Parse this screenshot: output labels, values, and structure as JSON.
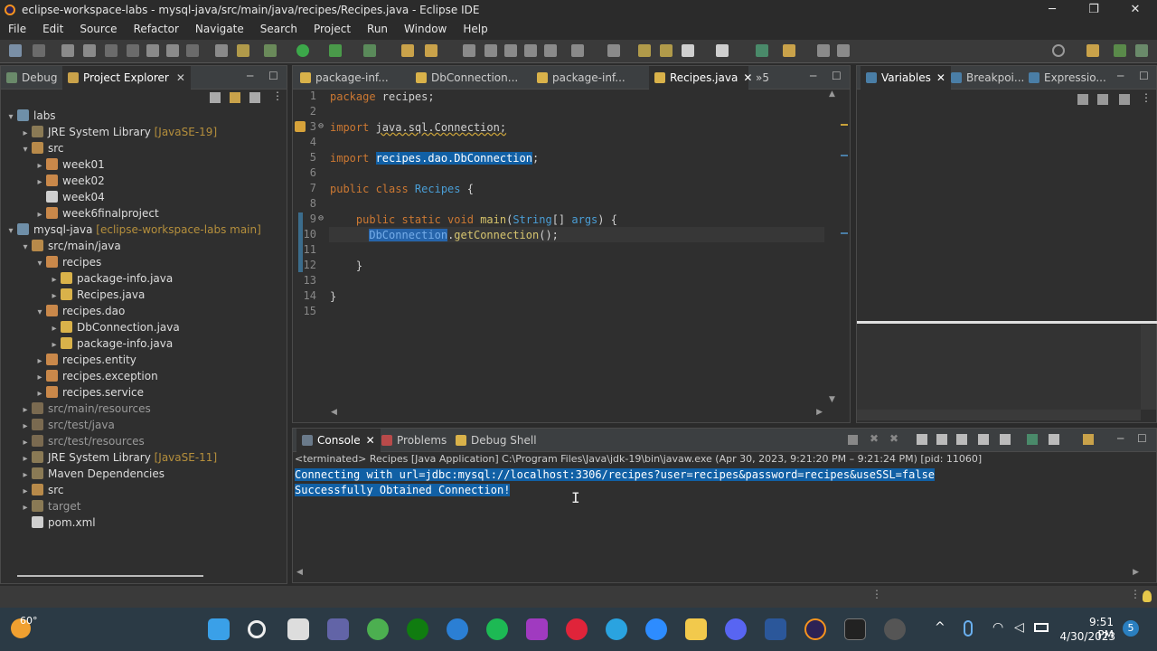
{
  "window": {
    "title": "eclipse-workspace-labs - mysql-java/src/main/java/recipes/Recipes.java - Eclipse IDE",
    "minimize": "─",
    "maximize": "❐",
    "close": "✕"
  },
  "menu": [
    "File",
    "Edit",
    "Source",
    "Refactor",
    "Navigate",
    "Search",
    "Project",
    "Run",
    "Window",
    "Help"
  ],
  "left_tabs": {
    "debug": "Debug",
    "project_explorer": "Project Explorer"
  },
  "tree": [
    {
      "label": "labs",
      "deco": "",
      "depth": 0,
      "arrow": "▾",
      "icon": "#6f8fa8"
    },
    {
      "label": "JRE System Library ",
      "deco": "[JavaSE-19]",
      "depth": 1,
      "arrow": "▸",
      "icon": "#8a7a55"
    },
    {
      "label": "src",
      "deco": "",
      "depth": 1,
      "arrow": "▾",
      "icon": "#b88a4a"
    },
    {
      "label": "week01",
      "deco": "",
      "depth": 2,
      "arrow": "▸",
      "icon": "#c9884a"
    },
    {
      "label": "week02",
      "deco": "",
      "depth": 2,
      "arrow": "▸",
      "icon": "#c9884a"
    },
    {
      "label": "week04",
      "deco": "",
      "depth": 2,
      "arrow": "",
      "icon": "#cfcfcf"
    },
    {
      "label": "week6finalproject",
      "deco": "",
      "depth": 2,
      "arrow": "▸",
      "icon": "#c9884a"
    },
    {
      "label": "mysql-java ",
      "deco": "[eclipse-workspace-labs main]",
      "depth": 0,
      "arrow": "▾",
      "icon": "#6f8fa8"
    },
    {
      "label": "src/main/java",
      "deco": "",
      "depth": 1,
      "arrow": "▾",
      "icon": "#b88a4a"
    },
    {
      "label": "recipes",
      "deco": "",
      "depth": 2,
      "arrow": "▾",
      "icon": "#c9884a"
    },
    {
      "label": "package-info.java",
      "deco": "",
      "depth": 3,
      "arrow": "▸",
      "icon": "#d9b24a"
    },
    {
      "label": "Recipes.java",
      "deco": "",
      "depth": 3,
      "arrow": "▸",
      "icon": "#d9b24a"
    },
    {
      "label": "recipes.dao",
      "deco": "",
      "depth": 2,
      "arrow": "▾",
      "icon": "#c9884a"
    },
    {
      "label": "DbConnection.java",
      "deco": "",
      "depth": 3,
      "arrow": "▸",
      "icon": "#d9b24a"
    },
    {
      "label": "package-info.java",
      "deco": "",
      "depth": 3,
      "arrow": "▸",
      "icon": "#d9b24a"
    },
    {
      "label": "recipes.entity",
      "deco": "",
      "depth": 2,
      "arrow": "▸",
      "icon": "#c9884a"
    },
    {
      "label": "recipes.exception",
      "deco": "",
      "depth": 2,
      "arrow": "▸",
      "icon": "#c9884a"
    },
    {
      "label": "recipes.service",
      "deco": "",
      "depth": 2,
      "arrow": "▸",
      "icon": "#c9884a"
    },
    {
      "label": "src/main/resources",
      "deco": "",
      "depth": 1,
      "arrow": "▸",
      "icon": "#7a6a50",
      "dim": true
    },
    {
      "label": "src/test/java",
      "deco": "",
      "depth": 1,
      "arrow": "▸",
      "icon": "#7a6a50",
      "dim": true
    },
    {
      "label": "src/test/resources",
      "deco": "",
      "depth": 1,
      "arrow": "▸",
      "icon": "#7a6a50",
      "dim": true
    },
    {
      "label": "JRE System Library ",
      "deco": "[JavaSE-11]",
      "depth": 1,
      "arrow": "▸",
      "icon": "#8a7a55"
    },
    {
      "label": "Maven Dependencies",
      "deco": "",
      "depth": 1,
      "arrow": "▸",
      "icon": "#8a7a55"
    },
    {
      "label": "src",
      "deco": "",
      "depth": 1,
      "arrow": "▸",
      "icon": "#b88a4a"
    },
    {
      "label": "target",
      "deco": "",
      "depth": 1,
      "arrow": "▸",
      "icon": "#8a7a55",
      "dim": true
    },
    {
      "label": "pom.xml",
      "deco": "",
      "depth": 1,
      "arrow": "",
      "icon": "#cfcfcf"
    }
  ],
  "editor_tabs": [
    {
      "label": "package-inf..."
    },
    {
      "label": "DbConnection..."
    },
    {
      "label": "package-inf..."
    },
    {
      "label": "Recipes.java",
      "active": true
    },
    {
      "label": "»5"
    }
  ],
  "code_lines": [
    {
      "n": "1",
      "parts": [
        [
          "kw",
          "package "
        ],
        [
          "pl",
          "recipes;"
        ]
      ]
    },
    {
      "n": "2",
      "parts": []
    },
    {
      "n": "3",
      "parts": [
        [
          "kw",
          "import "
        ],
        [
          "pl",
          "java.sql.Connection;"
        ]
      ]
    },
    {
      "n": "4",
      "parts": []
    },
    {
      "n": "5",
      "parts": [
        [
          "kw",
          "import "
        ],
        [
          "sel",
          "recipes.dao.DbConnection"
        ],
        [
          "pl",
          ";"
        ]
      ]
    },
    {
      "n": "6",
      "parts": []
    },
    {
      "n": "7",
      "parts": [
        [
          "kw",
          "public class "
        ],
        [
          "ty",
          "Recipes"
        ],
        [
          "pl",
          " {"
        ]
      ]
    },
    {
      "n": "8",
      "parts": []
    },
    {
      "n": "9",
      "parts": [
        [
          "pl",
          "    "
        ],
        [
          "kw",
          "public static void "
        ],
        [
          "mt",
          "main"
        ],
        [
          "pl",
          "("
        ],
        [
          "ty",
          "String"
        ],
        [
          "pl",
          "[] "
        ],
        [
          "ty",
          "args"
        ],
        [
          "pl",
          ") {"
        ]
      ]
    },
    {
      "n": "10",
      "parts": [
        [
          "pl",
          "      "
        ],
        [
          "sel2",
          "DbConnection"
        ],
        [
          "pl",
          "."
        ],
        [
          "mt",
          "getConnection"
        ],
        [
          "pl",
          "();"
        ]
      ]
    },
    {
      "n": "11",
      "parts": []
    },
    {
      "n": "12",
      "parts": [
        [
          "pl",
          "    }"
        ]
      ]
    },
    {
      "n": "13",
      "parts": []
    },
    {
      "n": "14",
      "parts": [
        [
          "pl",
          "}"
        ]
      ]
    },
    {
      "n": "15",
      "parts": []
    }
  ],
  "right_tabs": {
    "variables": "Variables",
    "breakpoints": "Breakpoi...",
    "expressions": "Expressio..."
  },
  "bottom_tabs": {
    "console": "Console",
    "problems": "Problems",
    "debug_shell": "Debug Shell"
  },
  "console": {
    "status": "<terminated> Recipes [Java Application] C:\\Program Files\\Java\\jdk-19\\bin\\javaw.exe  (Apr 30, 2023, 9:21:20 PM – 9:21:24 PM) [pid: 11060]",
    "lines": [
      "Connecting with url=jdbc:mysql://localhost:3306/recipes?user=recipes&password=recipes&useSSL=false",
      "Successfully Obtained Connection!"
    ]
  },
  "taskbar": {
    "weather": "60°",
    "time": "9:51 PM",
    "date": "4/30/2023",
    "notifications": "5"
  }
}
